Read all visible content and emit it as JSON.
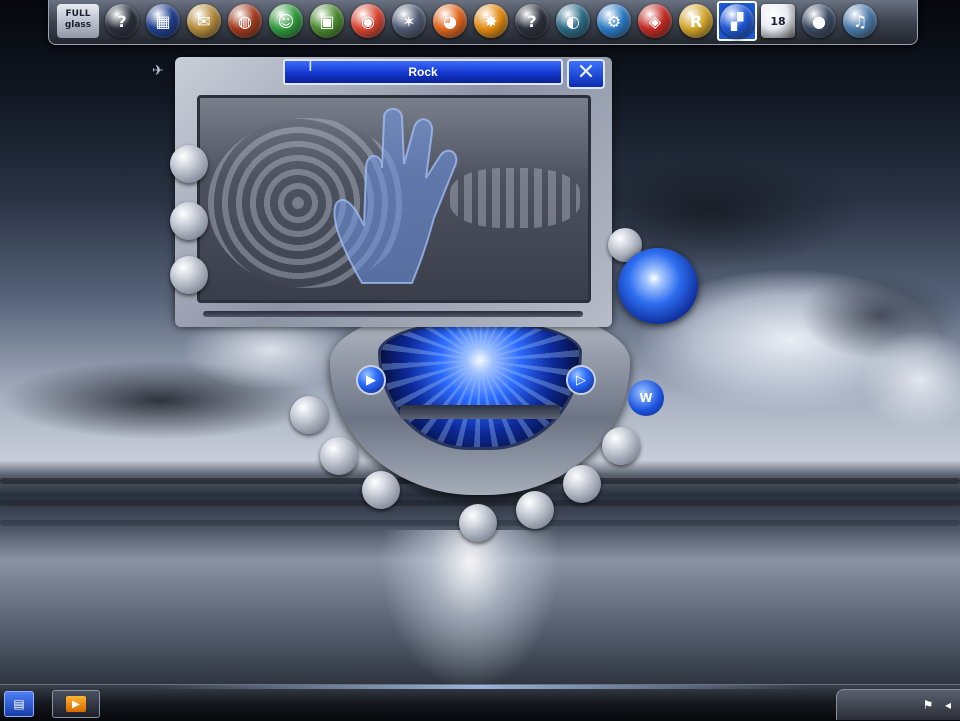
{
  "dock": {
    "full_glass_label_line1": "FULL",
    "full_glass_label_line2": "glass",
    "icons": [
      {
        "name": "help-icon",
        "glyph": "?",
        "color": "#2a2f3a"
      },
      {
        "name": "media-icon",
        "glyph": "▦",
        "color": "#1d3e8c"
      },
      {
        "name": "mail-icon",
        "glyph": "✉",
        "color": "#b38a3a"
      },
      {
        "name": "games-icon",
        "glyph": "◍",
        "color": "#a23a1e"
      },
      {
        "name": "messenger-icon",
        "glyph": "☺",
        "color": "#2f9a3c"
      },
      {
        "name": "photo-icon",
        "glyph": "▣",
        "color": "#4a8a2e"
      },
      {
        "name": "chrome-icon",
        "glyph": "◉",
        "color": "#d94432"
      },
      {
        "name": "network-icon",
        "glyph": "✶",
        "color": "#4e5a72"
      },
      {
        "name": "firefox-icon",
        "glyph": "◕",
        "color": "#e0651b"
      },
      {
        "name": "avast-icon",
        "glyph": "✸",
        "color": "#e08a10"
      },
      {
        "name": "help-icon-2",
        "glyph": "?",
        "color": "#2a2f3a"
      },
      {
        "name": "globe-icon",
        "glyph": "◐",
        "color": "#2c6a86"
      },
      {
        "name": "settings-icon",
        "glyph": "⚙",
        "color": "#2c7ac4"
      },
      {
        "name": "burn-icon",
        "glyph": "◈",
        "color": "#c22a22"
      },
      {
        "name": "winrar-icon",
        "glyph": "R",
        "color": "#d2a52a"
      },
      {
        "name": "active-app-icon",
        "glyph": "▞",
        "color": "#1d58d8"
      },
      {
        "name": "calendar-icon",
        "glyph": "18",
        "color": "#e8ecf2"
      },
      {
        "name": "sphere-icon",
        "glyph": "●",
        "color": "#3a4a62"
      },
      {
        "name": "music-folder-icon",
        "glyph": "♫",
        "color": "#4a7aa8"
      }
    ]
  },
  "player": {
    "title": "Rock",
    "close_glyph": "✕"
  },
  "deck": {
    "left_button_glyph": "▶",
    "right_button_glyph": "▷",
    "side_button_glyph": "W"
  },
  "taskbar": {
    "start_glyph": "▤",
    "task_glyph": "▶"
  }
}
